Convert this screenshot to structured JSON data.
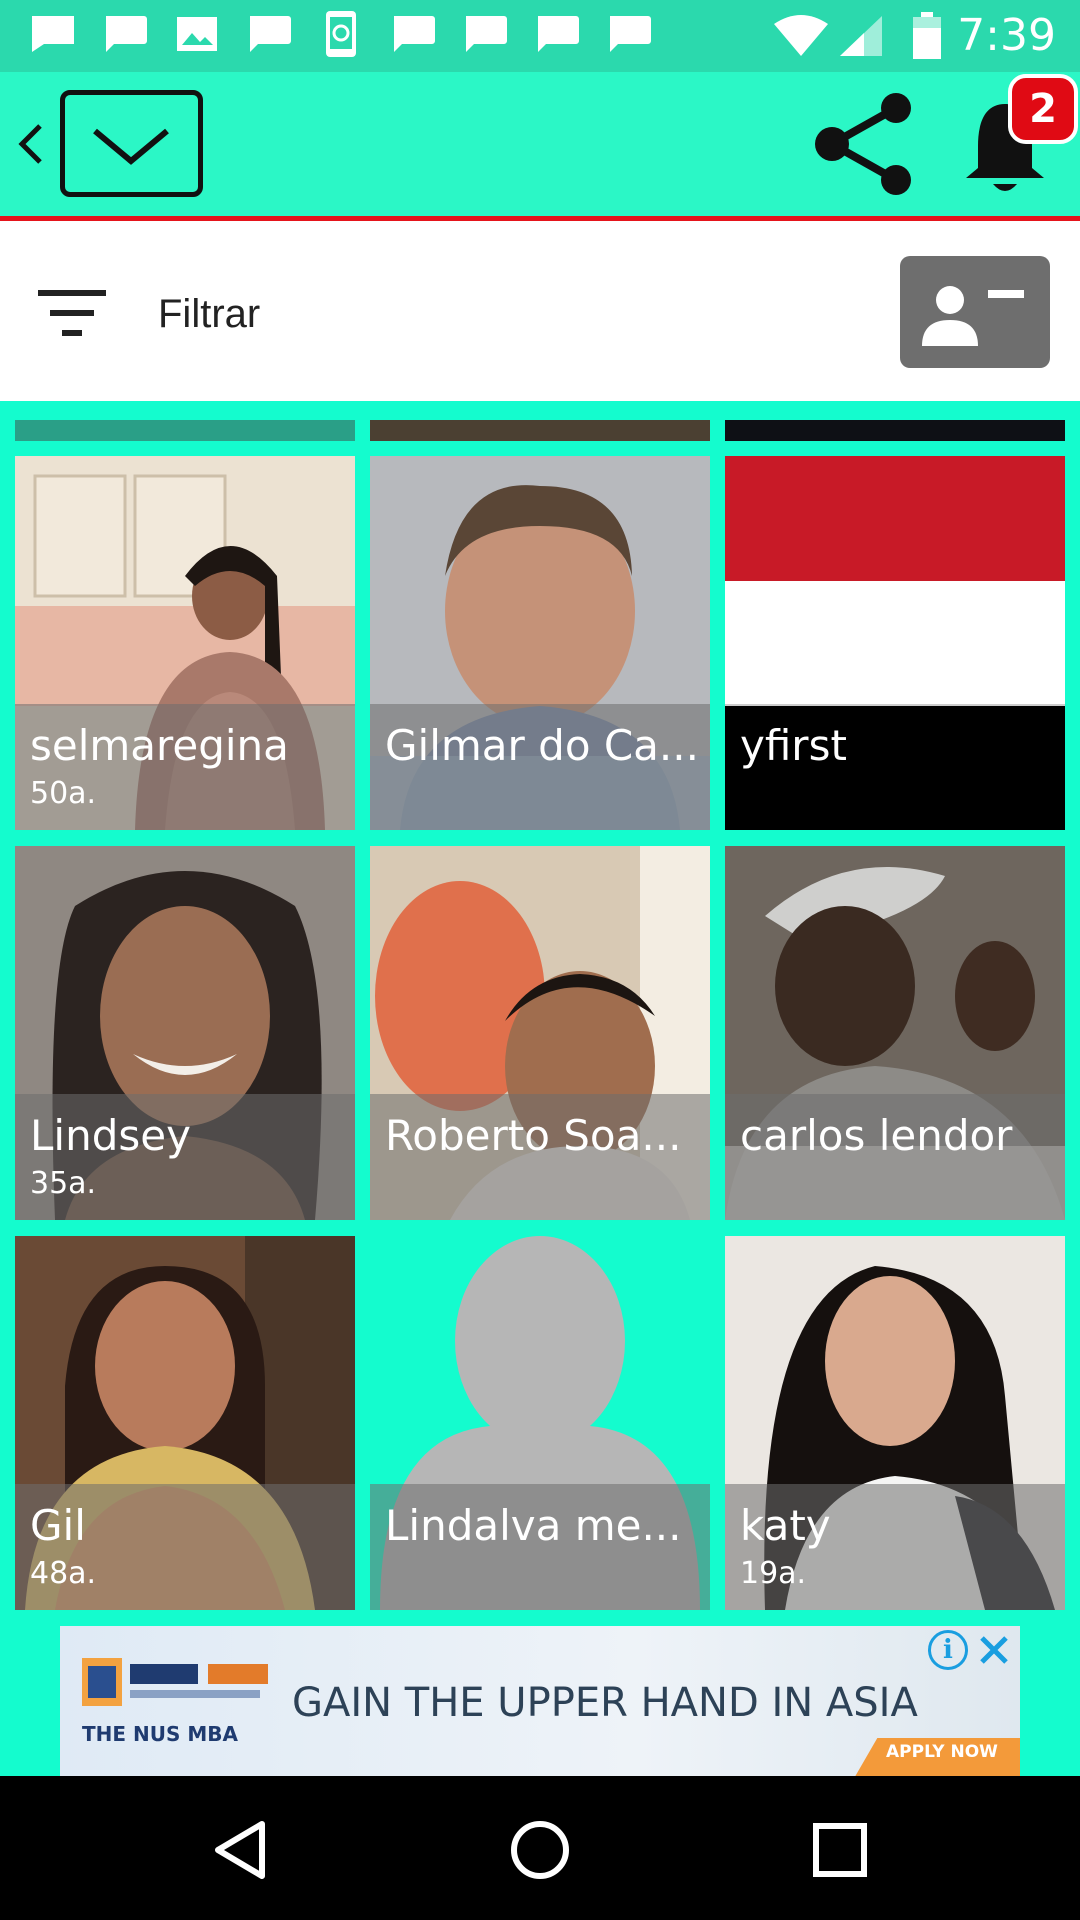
{
  "status_bar": {
    "time": "7:39",
    "icons": [
      "message-icon",
      "chat-icon",
      "image-icon",
      "chat-icon",
      "phone-sync-icon",
      "chat-icon",
      "chat-icon",
      "chat-icon",
      "chat-icon",
      "wifi-icon",
      "signal-icon",
      "battery-icon"
    ]
  },
  "app_bar": {
    "icons": [
      "chevron-left-icon",
      "mail-icon",
      "share-icon",
      "bell-icon"
    ],
    "notification_count": "2",
    "accent_color": "#2bf7c6",
    "underline_color": "#e5141b"
  },
  "filter": {
    "label": "Filtrar"
  },
  "grid": {
    "background": "#14fcce",
    "profiles": [
      {
        "name": "selmaregina",
        "age": "50a."
      },
      {
        "name": "Gilmar do Ca...",
        "age": ""
      },
      {
        "name": "yfirst",
        "age": ""
      },
      {
        "name": "Lindsey",
        "age": "35a."
      },
      {
        "name": "Roberto Soa...",
        "age": ""
      },
      {
        "name": "carlos lendor",
        "age": ""
      },
      {
        "name": "Gil",
        "age": "48a."
      },
      {
        "name": "Lindalva me...",
        "age": ""
      },
      {
        "name": "katy",
        "age": "19a."
      }
    ]
  },
  "ad": {
    "headline": "GAIN THE UPPER HAND IN ASIA",
    "brand": "THE NUS MBA",
    "cta": "APPLY NOW"
  },
  "nav_bar": {
    "buttons": [
      "back-icon",
      "home-icon",
      "recents-icon"
    ]
  }
}
